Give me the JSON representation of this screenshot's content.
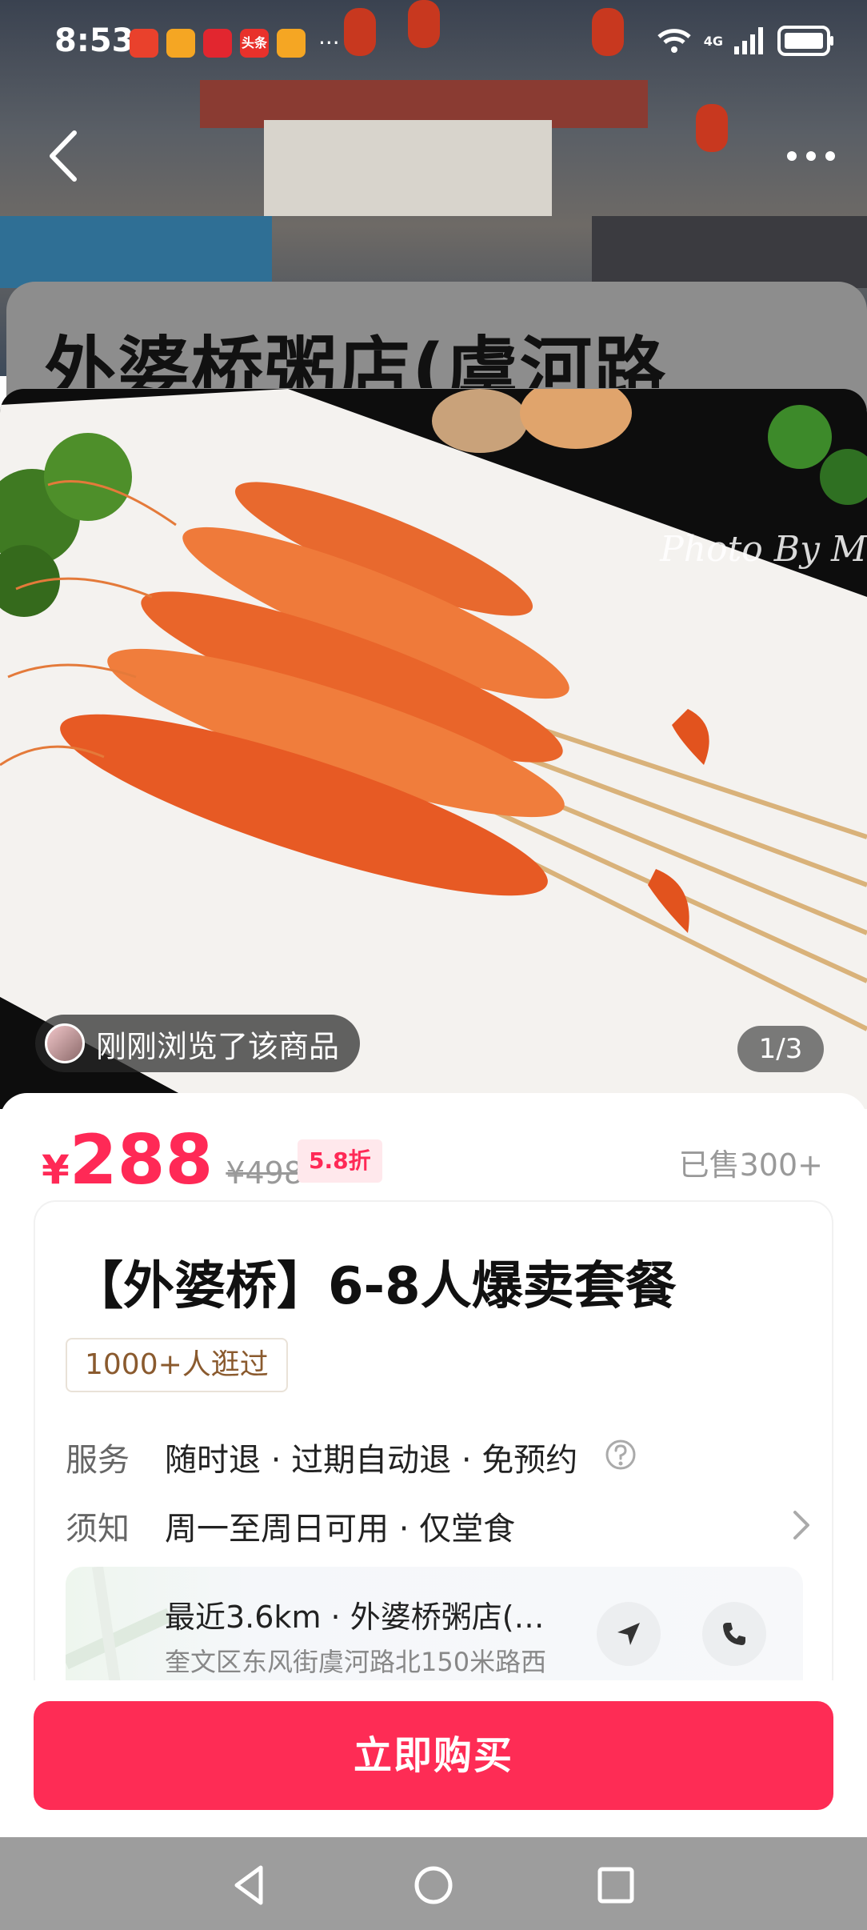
{
  "status_bar": {
    "time": "8:53",
    "apps": [
      {
        "name": "notification-app-icon",
        "label": "",
        "color": "#e9412c"
      },
      {
        "name": "weibo-icon",
        "label": "",
        "color": "#f5a623"
      },
      {
        "name": "video-app-icon",
        "label": "",
        "color": "#e2262f"
      },
      {
        "name": "toutiao-icon",
        "label": "头条",
        "color": "#e8312b"
      },
      {
        "name": "weibo-icon-2",
        "label": "",
        "color": "#f5a623"
      }
    ],
    "more": "···",
    "network": "4G"
  },
  "header": {
    "shop_title": "外婆桥粥店(虞河路"
  },
  "photo": {
    "credit": "Photo By M",
    "viewed_badge": "刚刚浏览了该商品",
    "counter": "1/3"
  },
  "price": {
    "symbol": "¥",
    "value": "288",
    "original": "¥498",
    "discount": "5.8折",
    "sold": "已售300+"
  },
  "product": {
    "title": "【外婆桥】6-8人爆卖套餐",
    "visits_tag": "1000+人逛过"
  },
  "details": {
    "service_label": "服务",
    "service_value": "随时退 · 过期自动退 · 免预约",
    "notice_label": "须知",
    "notice_value": "周一至周日可用 · 仅堂食"
  },
  "store": {
    "name": "最近3.6km · 外婆桥粥店(…",
    "address": "奎文区东风街虞河路北150米路西"
  },
  "buy": {
    "label": "立即购买"
  },
  "colors": {
    "accent": "#fe2c55",
    "price": "#ff2956",
    "tag_text": "#8a5a2e"
  }
}
